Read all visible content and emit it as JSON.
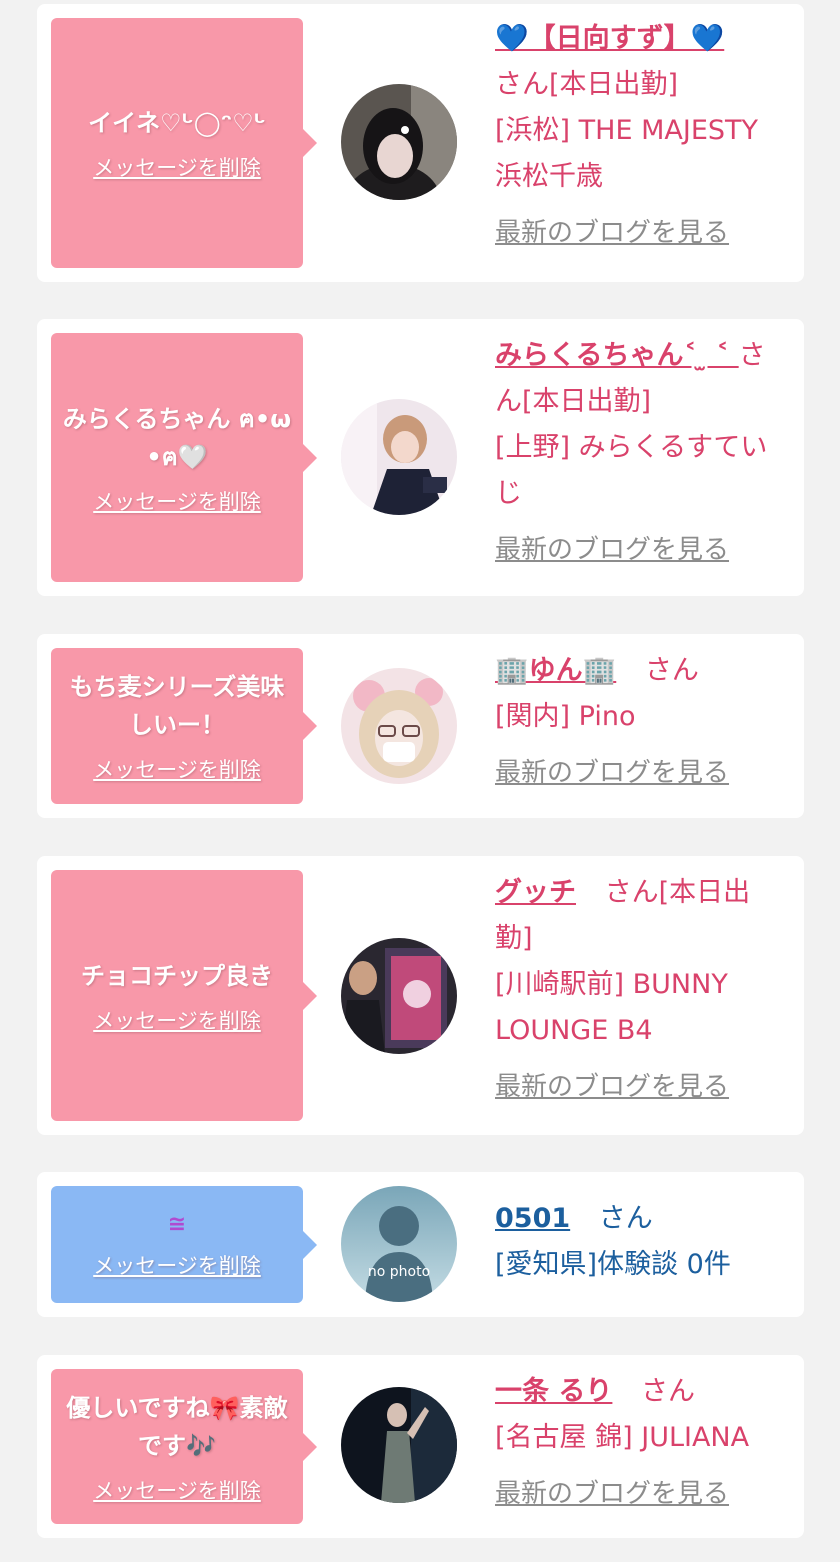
{
  "delete_label": "メッセージを削除",
  "blog_label": "最新のブログを見る",
  "san": "さん",
  "cards": [
    {
      "message": "イイネ♡ᒡ◯ᵔ♡ᒡ",
      "name": "💙【日向すず】💙",
      "status": "さん[本日出勤]",
      "shop": "[浜松] THE MAJESTY 浜松千歳"
    },
    {
      "message": "みらくるちゃん ฅ•ω•ฅ🤍",
      "name": "みらくるちゃん˂ ̫ ˂ ",
      "status": "さん[本日出勤]",
      "shop": "[上野] みらくるすていじ"
    },
    {
      "message": "もち麦シリーズ美味しいー！",
      "name": "🏢ゆん🏢",
      "status": "さん",
      "shop": "[関内] Pino"
    },
    {
      "message": "チョコチップ良き",
      "name": "グッチ",
      "status": "さん[本日出勤]",
      "shop": "[川崎駅前] BUNNY LOUNGE B4"
    },
    {
      "message": "≅",
      "name": "0501",
      "status": "さん",
      "shop": "[愛知県]体験談 0件",
      "avatar_text": "no photo"
    },
    {
      "message": "優しいですね🎀素敵です🎶",
      "name": "一条 るり",
      "status": "さん",
      "shop": "[名古屋 錦] JULIANA"
    }
  ]
}
